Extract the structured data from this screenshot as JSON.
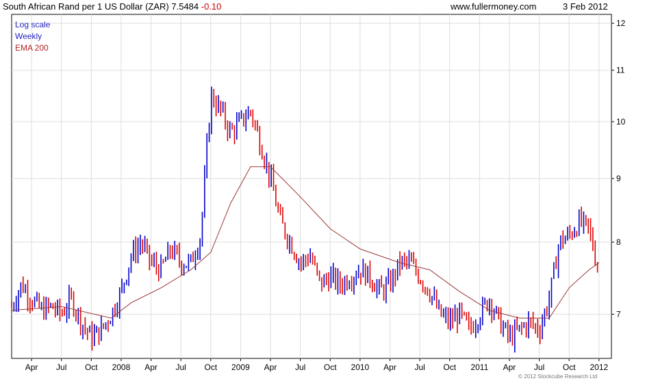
{
  "header": {
    "title_prefix": "South African Rand per 1 US Dollar (ZAR) 7.5484",
    "change": "-0.10",
    "website": "www.fullermoney.com",
    "date": "3 Feb 2012"
  },
  "legend": [
    "Log scale",
    "Weekly",
    "EMA 200"
  ],
  "copyright": "© 2012 Stockcube Research Ltd",
  "colors": {
    "up": "#0000cc",
    "down": "#dd0000",
    "ema": "#993333",
    "grid": "#dddddd"
  },
  "chart_data": {
    "type": "line",
    "title": "South African Rand per 1 US Dollar (ZAR) 7.5484 -0.10",
    "scale": "log",
    "ylim": [
      6.45,
      12.2
    ],
    "y_ticks": [
      7,
      8,
      9,
      10,
      11,
      12
    ],
    "x_tick_labels": [
      "Apr",
      "Jul",
      "Oct",
      "2008",
      "Apr",
      "Jul",
      "Oct",
      "2009",
      "Apr",
      "Jul",
      "Oct",
      "2010",
      "Apr",
      "Jul",
      "Oct",
      "2011",
      "Apr",
      "Jul",
      "Oct",
      "2012"
    ],
    "grid": true,
    "series": [
      {
        "name": "Weekly",
        "x": [
          "2007-02",
          "2007-03",
          "2007-04",
          "2007-05",
          "2007-06",
          "2007-07",
          "2007-08",
          "2007-09",
          "2007-10",
          "2007-11",
          "2007-12",
          "2008-01",
          "2008-02",
          "2008-03",
          "2008-04",
          "2008-05",
          "2008-06",
          "2008-07",
          "2008-08",
          "2008-09",
          "2008-10",
          "2008-11",
          "2008-12",
          "2009-01",
          "2009-02",
          "2009-03",
          "2009-04",
          "2009-05",
          "2009-06",
          "2009-07",
          "2009-08",
          "2009-09",
          "2009-10",
          "2009-11",
          "2009-12",
          "2010-01",
          "2010-02",
          "2010-03",
          "2010-04",
          "2010-05",
          "2010-06",
          "2010-07",
          "2010-08",
          "2010-09",
          "2010-10",
          "2010-11",
          "2010-12",
          "2011-01",
          "2011-02",
          "2011-03",
          "2011-04",
          "2011-05",
          "2011-06",
          "2011-07",
          "2011-08",
          "2011-09",
          "2011-10",
          "2011-11",
          "2011-12",
          "2012-01"
        ],
        "values": [
          7.1,
          7.4,
          7.2,
          7.05,
          7.1,
          7.0,
          7.2,
          6.9,
          6.7,
          6.8,
          7.0,
          7.3,
          7.8,
          8.0,
          7.7,
          7.6,
          7.9,
          7.7,
          7.7,
          8.1,
          10.5,
          10.2,
          9.8,
          10.0,
          10.2,
          9.6,
          9.0,
          8.3,
          8.0,
          7.7,
          7.8,
          7.4,
          7.5,
          7.4,
          7.5,
          7.6,
          7.5,
          7.3,
          7.4,
          7.7,
          7.7,
          7.5,
          7.3,
          7.0,
          6.9,
          7.0,
          6.8,
          7.0,
          7.2,
          6.9,
          6.7,
          6.8,
          6.9,
          6.8,
          7.2,
          8.0,
          8.1,
          8.3,
          8.2,
          7.55
        ]
      },
      {
        "name": "EMA 200",
        "x": [
          "2007-02",
          "2007-07",
          "2007-12",
          "2008-02",
          "2008-05",
          "2008-08",
          "2008-10",
          "2008-12",
          "2009-02",
          "2009-04",
          "2009-07",
          "2009-10",
          "2010-01",
          "2010-05",
          "2010-08",
          "2010-11",
          "2011-02",
          "2011-05",
          "2011-08",
          "2011-10",
          "2011-12",
          "2012-01"
        ],
        "values": [
          7.05,
          7.1,
          6.95,
          7.15,
          7.35,
          7.6,
          7.85,
          8.6,
          9.2,
          9.2,
          8.7,
          8.2,
          7.9,
          7.7,
          7.6,
          7.3,
          7.05,
          6.95,
          6.95,
          7.35,
          7.6,
          7.7
        ]
      }
    ]
  }
}
